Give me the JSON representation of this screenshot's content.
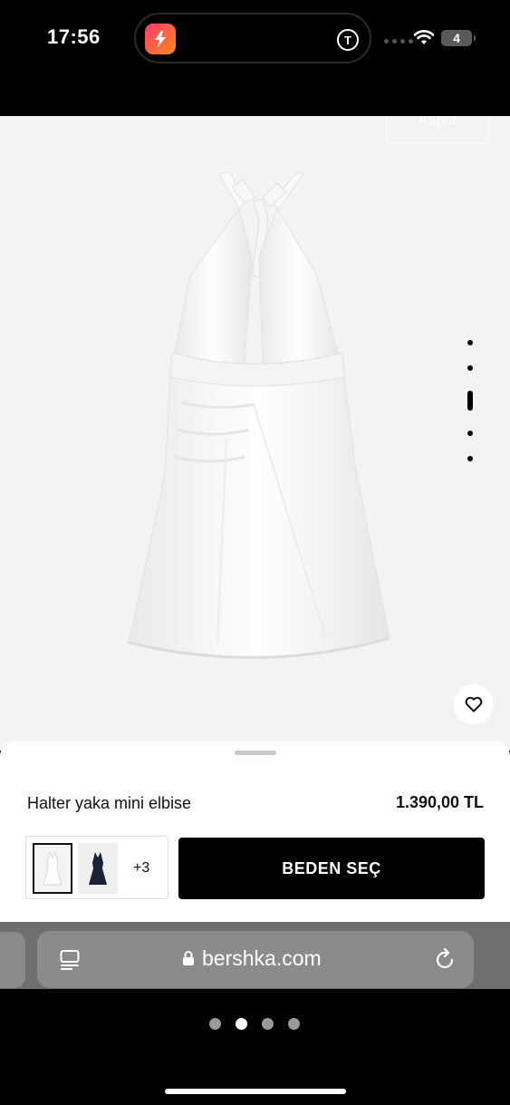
{
  "status_bar": {
    "time": "17:56",
    "battery": "4",
    "app_icon": "lightning-icon",
    "island_badge": "T"
  },
  "viewer": {
    "close_label": "Kapat",
    "image_count": 5,
    "active_image_index": 2
  },
  "product": {
    "name": "Halter yaka mini elbise",
    "price": "1.390,00 TL",
    "more_colors": "+3",
    "size_button_label": "BEDEN SEÇ",
    "colors": [
      {
        "name": "white",
        "hex": "#ffffff"
      },
      {
        "name": "navy",
        "hex": "#1c2236"
      }
    ]
  },
  "browser": {
    "url": "bershka.com"
  },
  "pager": {
    "count": 4,
    "active_index": 1
  }
}
